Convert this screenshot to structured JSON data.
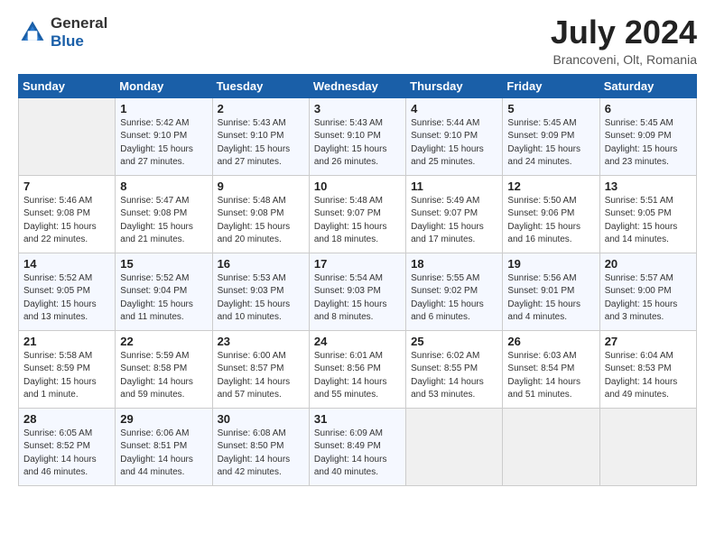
{
  "header": {
    "logo_general": "General",
    "logo_blue": "Blue",
    "month_title": "July 2024",
    "location": "Brancoveni, Olt, Romania"
  },
  "weekdays": [
    "Sunday",
    "Monday",
    "Tuesday",
    "Wednesday",
    "Thursday",
    "Friday",
    "Saturday"
  ],
  "weeks": [
    [
      {
        "num": "",
        "detail": ""
      },
      {
        "num": "1",
        "detail": "Sunrise: 5:42 AM\nSunset: 9:10 PM\nDaylight: 15 hours\nand 27 minutes."
      },
      {
        "num": "2",
        "detail": "Sunrise: 5:43 AM\nSunset: 9:10 PM\nDaylight: 15 hours\nand 27 minutes."
      },
      {
        "num": "3",
        "detail": "Sunrise: 5:43 AM\nSunset: 9:10 PM\nDaylight: 15 hours\nand 26 minutes."
      },
      {
        "num": "4",
        "detail": "Sunrise: 5:44 AM\nSunset: 9:10 PM\nDaylight: 15 hours\nand 25 minutes."
      },
      {
        "num": "5",
        "detail": "Sunrise: 5:45 AM\nSunset: 9:09 PM\nDaylight: 15 hours\nand 24 minutes."
      },
      {
        "num": "6",
        "detail": "Sunrise: 5:45 AM\nSunset: 9:09 PM\nDaylight: 15 hours\nand 23 minutes."
      }
    ],
    [
      {
        "num": "7",
        "detail": "Sunrise: 5:46 AM\nSunset: 9:08 PM\nDaylight: 15 hours\nand 22 minutes."
      },
      {
        "num": "8",
        "detail": "Sunrise: 5:47 AM\nSunset: 9:08 PM\nDaylight: 15 hours\nand 21 minutes."
      },
      {
        "num": "9",
        "detail": "Sunrise: 5:48 AM\nSunset: 9:08 PM\nDaylight: 15 hours\nand 20 minutes."
      },
      {
        "num": "10",
        "detail": "Sunrise: 5:48 AM\nSunset: 9:07 PM\nDaylight: 15 hours\nand 18 minutes."
      },
      {
        "num": "11",
        "detail": "Sunrise: 5:49 AM\nSunset: 9:07 PM\nDaylight: 15 hours\nand 17 minutes."
      },
      {
        "num": "12",
        "detail": "Sunrise: 5:50 AM\nSunset: 9:06 PM\nDaylight: 15 hours\nand 16 minutes."
      },
      {
        "num": "13",
        "detail": "Sunrise: 5:51 AM\nSunset: 9:05 PM\nDaylight: 15 hours\nand 14 minutes."
      }
    ],
    [
      {
        "num": "14",
        "detail": "Sunrise: 5:52 AM\nSunset: 9:05 PM\nDaylight: 15 hours\nand 13 minutes."
      },
      {
        "num": "15",
        "detail": "Sunrise: 5:52 AM\nSunset: 9:04 PM\nDaylight: 15 hours\nand 11 minutes."
      },
      {
        "num": "16",
        "detail": "Sunrise: 5:53 AM\nSunset: 9:03 PM\nDaylight: 15 hours\nand 10 minutes."
      },
      {
        "num": "17",
        "detail": "Sunrise: 5:54 AM\nSunset: 9:03 PM\nDaylight: 15 hours\nand 8 minutes."
      },
      {
        "num": "18",
        "detail": "Sunrise: 5:55 AM\nSunset: 9:02 PM\nDaylight: 15 hours\nand 6 minutes."
      },
      {
        "num": "19",
        "detail": "Sunrise: 5:56 AM\nSunset: 9:01 PM\nDaylight: 15 hours\nand 4 minutes."
      },
      {
        "num": "20",
        "detail": "Sunrise: 5:57 AM\nSunset: 9:00 PM\nDaylight: 15 hours\nand 3 minutes."
      }
    ],
    [
      {
        "num": "21",
        "detail": "Sunrise: 5:58 AM\nSunset: 8:59 PM\nDaylight: 15 hours\nand 1 minute."
      },
      {
        "num": "22",
        "detail": "Sunrise: 5:59 AM\nSunset: 8:58 PM\nDaylight: 14 hours\nand 59 minutes."
      },
      {
        "num": "23",
        "detail": "Sunrise: 6:00 AM\nSunset: 8:57 PM\nDaylight: 14 hours\nand 57 minutes."
      },
      {
        "num": "24",
        "detail": "Sunrise: 6:01 AM\nSunset: 8:56 PM\nDaylight: 14 hours\nand 55 minutes."
      },
      {
        "num": "25",
        "detail": "Sunrise: 6:02 AM\nSunset: 8:55 PM\nDaylight: 14 hours\nand 53 minutes."
      },
      {
        "num": "26",
        "detail": "Sunrise: 6:03 AM\nSunset: 8:54 PM\nDaylight: 14 hours\nand 51 minutes."
      },
      {
        "num": "27",
        "detail": "Sunrise: 6:04 AM\nSunset: 8:53 PM\nDaylight: 14 hours\nand 49 minutes."
      }
    ],
    [
      {
        "num": "28",
        "detail": "Sunrise: 6:05 AM\nSunset: 8:52 PM\nDaylight: 14 hours\nand 46 minutes."
      },
      {
        "num": "29",
        "detail": "Sunrise: 6:06 AM\nSunset: 8:51 PM\nDaylight: 14 hours\nand 44 minutes."
      },
      {
        "num": "30",
        "detail": "Sunrise: 6:08 AM\nSunset: 8:50 PM\nDaylight: 14 hours\nand 42 minutes."
      },
      {
        "num": "31",
        "detail": "Sunrise: 6:09 AM\nSunset: 8:49 PM\nDaylight: 14 hours\nand 40 minutes."
      },
      {
        "num": "",
        "detail": ""
      },
      {
        "num": "",
        "detail": ""
      },
      {
        "num": "",
        "detail": ""
      }
    ]
  ]
}
